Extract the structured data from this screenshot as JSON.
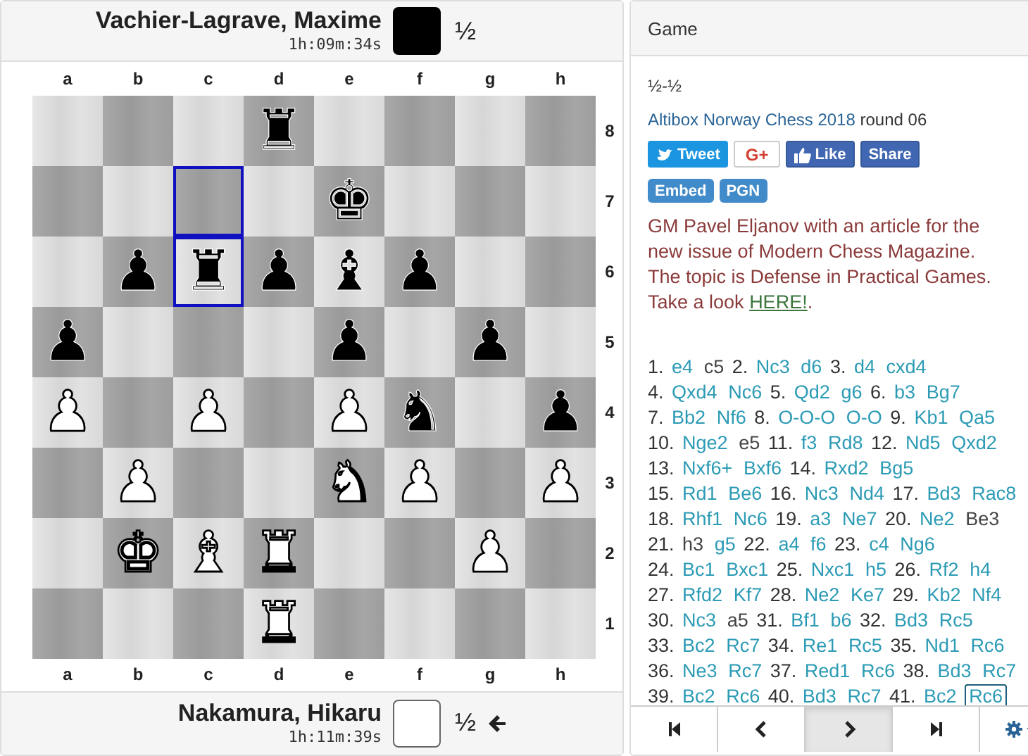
{
  "players": {
    "top": {
      "name": "Vachier-Lagrave, Maxime",
      "clock": "1h:09m:34s",
      "white": false,
      "score": "½",
      "to_move": false
    },
    "bottom": {
      "name": "Nakamura, Hikaru",
      "clock": "1h:11m:39s",
      "white": true,
      "score": "½",
      "to_move": true
    }
  },
  "board": {
    "files_top": [
      "a",
      "b",
      "c",
      "d",
      "e",
      "f",
      "g",
      "h"
    ],
    "ranks": [
      {
        "label": "8",
        "squares": [
          {
            "highlighted": false
          },
          {
            "highlighted": false
          },
          {
            "highlighted": false
          },
          {
            "piece": "♜",
            "white": false,
            "highlighted": false
          },
          {
            "highlighted": false
          },
          {
            "highlighted": false
          },
          {
            "highlighted": false
          },
          {
            "highlighted": false
          }
        ]
      },
      {
        "label": "7",
        "squares": [
          {
            "highlighted": false
          },
          {
            "highlighted": false
          },
          {
            "highlighted": true
          },
          {
            "highlighted": false
          },
          {
            "piece": "♚",
            "white": false,
            "highlighted": false
          },
          {
            "highlighted": false
          },
          {
            "highlighted": false
          },
          {
            "highlighted": false
          }
        ]
      },
      {
        "label": "6",
        "squares": [
          {
            "highlighted": false
          },
          {
            "piece": "♟",
            "white": false,
            "highlighted": false
          },
          {
            "piece": "♜",
            "white": false,
            "highlighted": true
          },
          {
            "piece": "♟",
            "white": false,
            "highlighted": false
          },
          {
            "piece": "♝",
            "white": false,
            "highlighted": false
          },
          {
            "piece": "♟",
            "white": false,
            "highlighted": false
          },
          {
            "highlighted": false
          },
          {
            "highlighted": false
          }
        ]
      },
      {
        "label": "5",
        "squares": [
          {
            "piece": "♟",
            "white": false,
            "highlighted": false
          },
          {
            "highlighted": false
          },
          {
            "highlighted": false
          },
          {
            "highlighted": false
          },
          {
            "piece": "♟",
            "white": false,
            "highlighted": false
          },
          {
            "highlighted": false
          },
          {
            "piece": "♟",
            "white": false,
            "highlighted": false
          },
          {
            "highlighted": false
          }
        ]
      },
      {
        "label": "4",
        "squares": [
          {
            "piece": "♟",
            "white": true,
            "highlighted": false
          },
          {
            "highlighted": false
          },
          {
            "piece": "♟",
            "white": true,
            "highlighted": false
          },
          {
            "highlighted": false
          },
          {
            "piece": "♟",
            "white": true,
            "highlighted": false
          },
          {
            "piece": "♞",
            "white": false,
            "highlighted": false
          },
          {
            "highlighted": false
          },
          {
            "piece": "♟",
            "white": false,
            "highlighted": false
          }
        ]
      },
      {
        "label": "3",
        "squares": [
          {
            "highlighted": false
          },
          {
            "piece": "♟",
            "white": true,
            "highlighted": false
          },
          {
            "highlighted": false
          },
          {
            "highlighted": false
          },
          {
            "piece": "♞",
            "white": true,
            "highlighted": false
          },
          {
            "piece": "♟",
            "white": true,
            "highlighted": false
          },
          {
            "highlighted": false
          },
          {
            "piece": "♟",
            "white": true,
            "highlighted": false
          }
        ]
      },
      {
        "label": "2",
        "squares": [
          {
            "highlighted": false
          },
          {
            "piece": "♚",
            "white": true,
            "highlighted": false
          },
          {
            "piece": "♝",
            "white": true,
            "highlighted": false
          },
          {
            "piece": "♜",
            "white": true,
            "highlighted": false
          },
          {
            "highlighted": false
          },
          {
            "highlighted": false
          },
          {
            "piece": "♟",
            "white": true,
            "highlighted": false
          },
          {
            "highlighted": false
          }
        ]
      },
      {
        "label": "1",
        "squares": [
          {
            "highlighted": false
          },
          {
            "highlighted": false
          },
          {
            "highlighted": false
          },
          {
            "piece": "♜",
            "white": true,
            "highlighted": false
          },
          {
            "highlighted": false
          },
          {
            "highlighted": false
          },
          {
            "highlighted": false
          },
          {
            "highlighted": false
          }
        ]
      }
    ],
    "files_bottom": [
      "a",
      "b",
      "c",
      "d",
      "e",
      "f",
      "g",
      "h"
    ]
  },
  "panel": {
    "title": "Game",
    "result": "½-½",
    "event": {
      "name": "Altibox Norway Chess 2018",
      "round": "round 06"
    },
    "share_buttons": [
      {
        "kind": "tweet",
        "label": "Tweet"
      },
      {
        "kind": "gplus",
        "label": "G+"
      },
      {
        "kind": "like",
        "label": "Like"
      },
      {
        "kind": "share",
        "label": "Share"
      }
    ],
    "export_buttons": [
      "Embed",
      "PGN"
    ],
    "promo": {
      "text": "GM Pavel Eljanov with an article for the new issue of Modern Chess Magazine. The topic is Defense in Practical Games. Take a look",
      "link": "HERE!",
      "tail": "."
    },
    "move_lines": [
      [
        {
          "number": "1.",
          "white": {
            "san": "e4",
            "linked": true,
            "selected": false
          },
          "black": {
            "san": "c5",
            "linked": false,
            "selected": false
          }
        },
        {
          "number": "2.",
          "white": {
            "san": "Nc3",
            "linked": true,
            "selected": false
          },
          "black": {
            "san": "d6",
            "linked": true,
            "selected": false
          }
        },
        {
          "number": "3.",
          "white": {
            "san": "d4",
            "linked": true,
            "selected": false
          },
          "black": {
            "san": "cxd4",
            "linked": true,
            "selected": false
          }
        }
      ],
      [
        {
          "number": "4.",
          "white": {
            "san": "Qxd4",
            "linked": true,
            "selected": false
          },
          "black": {
            "san": "Nc6",
            "linked": true,
            "selected": false
          }
        },
        {
          "number": "5.",
          "white": {
            "san": "Qd2",
            "linked": true,
            "selected": false
          },
          "black": {
            "san": "g6",
            "linked": true,
            "selected": false
          }
        },
        {
          "number": "6.",
          "white": {
            "san": "b3",
            "linked": true,
            "selected": false
          },
          "black": {
            "san": "Bg7",
            "linked": true,
            "selected": false
          }
        }
      ],
      [
        {
          "number": "7.",
          "white": {
            "san": "Bb2",
            "linked": true,
            "selected": false
          },
          "black": {
            "san": "Nf6",
            "linked": true,
            "selected": false
          }
        },
        {
          "number": "8.",
          "white": {
            "san": "O-O-O",
            "linked": true,
            "selected": false
          },
          "black": {
            "san": "O-O",
            "linked": true,
            "selected": false
          }
        },
        {
          "number": "9.",
          "white": {
            "san": "Kb1",
            "linked": true,
            "selected": false
          },
          "black": {
            "san": "Qa5",
            "linked": true,
            "selected": false
          }
        }
      ],
      [
        {
          "number": "10.",
          "white": {
            "san": "Nge2",
            "linked": true,
            "selected": false
          },
          "black": {
            "san": "e5",
            "linked": false,
            "selected": false
          }
        },
        {
          "number": "11.",
          "white": {
            "san": "f3",
            "linked": true,
            "selected": false
          },
          "black": {
            "san": "Rd8",
            "linked": true,
            "selected": false
          }
        },
        {
          "number": "12.",
          "white": {
            "san": "Nd5",
            "linked": true,
            "selected": false
          },
          "black": {
            "san": "Qxd2",
            "linked": true,
            "selected": false
          }
        }
      ],
      [
        {
          "number": "13.",
          "white": {
            "san": "Nxf6+",
            "linked": true,
            "selected": false
          },
          "black": {
            "san": "Bxf6",
            "linked": true,
            "selected": false
          }
        },
        {
          "number": "14.",
          "white": {
            "san": "Rxd2",
            "linked": true,
            "selected": false
          },
          "black": {
            "san": "Bg5",
            "linked": true,
            "selected": false
          }
        }
      ],
      [
        {
          "number": "15.",
          "white": {
            "san": "Rd1",
            "linked": true,
            "selected": false
          },
          "black": {
            "san": "Be6",
            "linked": true,
            "selected": false
          }
        },
        {
          "number": "16.",
          "white": {
            "san": "Nc3",
            "linked": true,
            "selected": false
          },
          "black": {
            "san": "Nd4",
            "linked": true,
            "selected": false
          }
        },
        {
          "number": "17.",
          "white": {
            "san": "Bd3",
            "linked": true,
            "selected": false
          },
          "black": {
            "san": "Rac8",
            "linked": true,
            "selected": false
          }
        }
      ],
      [
        {
          "number": "18.",
          "white": {
            "san": "Rhf1",
            "linked": true,
            "selected": false
          },
          "black": {
            "san": "Nc6",
            "linked": true,
            "selected": false
          }
        },
        {
          "number": "19.",
          "white": {
            "san": "a3",
            "linked": true,
            "selected": false
          },
          "black": {
            "san": "Ne7",
            "linked": true,
            "selected": false
          }
        },
        {
          "number": "20.",
          "white": {
            "san": "Ne2",
            "linked": true,
            "selected": false
          },
          "black": {
            "san": "Be3",
            "linked": false,
            "selected": false
          }
        }
      ],
      [
        {
          "number": "21.",
          "white": {
            "san": "h3",
            "linked": false,
            "selected": false
          },
          "black": {
            "san": "g5",
            "linked": true,
            "selected": false
          }
        },
        {
          "number": "22.",
          "white": {
            "san": "a4",
            "linked": true,
            "selected": false
          },
          "black": {
            "san": "f6",
            "linked": true,
            "selected": false
          }
        },
        {
          "number": "23.",
          "white": {
            "san": "c4",
            "linked": true,
            "selected": false
          },
          "black": {
            "san": "Ng6",
            "linked": true,
            "selected": false
          }
        }
      ],
      [
        {
          "number": "24.",
          "white": {
            "san": "Bc1",
            "linked": true,
            "selected": false
          },
          "black": {
            "san": "Bxc1",
            "linked": true,
            "selected": false
          }
        },
        {
          "number": "25.",
          "white": {
            "san": "Nxc1",
            "linked": true,
            "selected": false
          },
          "black": {
            "san": "h5",
            "linked": true,
            "selected": false
          }
        },
        {
          "number": "26.",
          "white": {
            "san": "Rf2",
            "linked": true,
            "selected": false
          },
          "black": {
            "san": "h4",
            "linked": true,
            "selected": false
          }
        }
      ],
      [
        {
          "number": "27.",
          "white": {
            "san": "Rfd2",
            "linked": true,
            "selected": false
          },
          "black": {
            "san": "Kf7",
            "linked": true,
            "selected": false
          }
        },
        {
          "number": "28.",
          "white": {
            "san": "Ne2",
            "linked": true,
            "selected": false
          },
          "black": {
            "san": "Ke7",
            "linked": true,
            "selected": false
          }
        },
        {
          "number": "29.",
          "white": {
            "san": "Kb2",
            "linked": true,
            "selected": false
          },
          "black": {
            "san": "Nf4",
            "linked": true,
            "selected": false
          }
        }
      ],
      [
        {
          "number": "30.",
          "white": {
            "san": "Nc3",
            "linked": true,
            "selected": false
          },
          "black": {
            "san": "a5",
            "linked": false,
            "selected": false
          }
        },
        {
          "number": "31.",
          "white": {
            "san": "Bf1",
            "linked": true,
            "selected": false
          },
          "black": {
            "san": "b6",
            "linked": true,
            "selected": false
          }
        },
        {
          "number": "32.",
          "white": {
            "san": "Bd3",
            "linked": true,
            "selected": false
          },
          "black": {
            "san": "Rc5",
            "linked": true,
            "selected": false
          }
        }
      ],
      [
        {
          "number": "33.",
          "white": {
            "san": "Bc2",
            "linked": true,
            "selected": false
          },
          "black": {
            "san": "Rc7",
            "linked": true,
            "selected": false
          }
        },
        {
          "number": "34.",
          "white": {
            "san": "Re1",
            "linked": true,
            "selected": false
          },
          "black": {
            "san": "Rc5",
            "linked": true,
            "selected": false
          }
        },
        {
          "number": "35.",
          "white": {
            "san": "Nd1",
            "linked": true,
            "selected": false
          },
          "black": {
            "san": "Rc6",
            "linked": true,
            "selected": false
          }
        }
      ],
      [
        {
          "number": "36.",
          "white": {
            "san": "Ne3",
            "linked": true,
            "selected": false
          },
          "black": {
            "san": "Rc7",
            "linked": true,
            "selected": false
          }
        },
        {
          "number": "37.",
          "white": {
            "san": "Red1",
            "linked": true,
            "selected": false
          },
          "black": {
            "san": "Rc6",
            "linked": true,
            "selected": false
          }
        },
        {
          "number": "38.",
          "white": {
            "san": "Bd3",
            "linked": true,
            "selected": false
          },
          "black": {
            "san": "Rc7",
            "linked": true,
            "selected": false
          }
        }
      ],
      [
        {
          "number": "39.",
          "white": {
            "san": "Bc2",
            "linked": true,
            "selected": false
          },
          "black": {
            "san": "Rc6",
            "linked": true,
            "selected": false
          }
        },
        {
          "number": "40.",
          "white": {
            "san": "Bd3",
            "linked": true,
            "selected": false
          },
          "black": {
            "san": "Rc7",
            "linked": true,
            "selected": false
          }
        },
        {
          "number": "41.",
          "white": {
            "san": "Bc2",
            "linked": true,
            "selected": false
          },
          "black": {
            "san": "Rc6",
            "linked": true,
            "selected": true
          }
        }
      ]
    ],
    "nav": [
      {
        "kind": "first",
        "pressed": false
      },
      {
        "kind": "prev",
        "pressed": false
      },
      {
        "kind": "next",
        "pressed": true
      },
      {
        "kind": "last",
        "pressed": false
      },
      {
        "kind": "settings",
        "pressed": false
      }
    ]
  }
}
